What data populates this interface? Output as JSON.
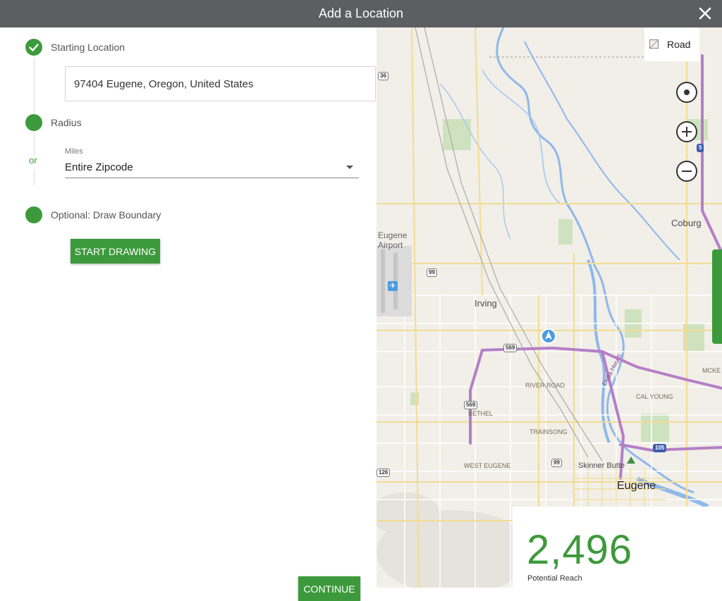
{
  "dialog": {
    "title": "Add a Location"
  },
  "steps": {
    "starting_location": {
      "label": "Starting Location",
      "address_value": "97404 Eugene, Oregon, United States"
    },
    "radius": {
      "label": "Radius",
      "or_label": "or",
      "miles_label": "Miles",
      "miles_value": "Entire Zipcode"
    },
    "draw": {
      "label": "Optional: Draw Boundary",
      "button_label": "START DRAWING"
    }
  },
  "footer": {
    "continue_label": "CONTINUE"
  },
  "map": {
    "style_label": "Road",
    "labels": {
      "coburg": "Coburg",
      "eugene_airport_1": "Eugene",
      "eugene_airport_2": "Airport",
      "irving": "Irving",
      "river_road": "RIVER ROAD",
      "bethel": "BETHEL",
      "cal_young": "CAL YOUNG",
      "trainsong": "TRAINSONG",
      "west_eugene": "WEST EUGENE",
      "skinner_butte": "Skinner Butte",
      "eugene": "Eugene",
      "mckenzie": "MCKE",
      "delta_hwy": "Delta Hwy S"
    },
    "shields": {
      "r36": "36",
      "r99a": "99",
      "r569a": "569",
      "r569b": "569",
      "r99b": "99",
      "r126": "126",
      "i5": "5",
      "i105": "105"
    }
  },
  "reach": {
    "value": "2,496",
    "label": "Potential Reach"
  },
  "colors": {
    "accent": "#3d9a3c",
    "titlebar": "#5d5e62",
    "highway": "#b57fc6",
    "water": "#8fb8ec"
  }
}
